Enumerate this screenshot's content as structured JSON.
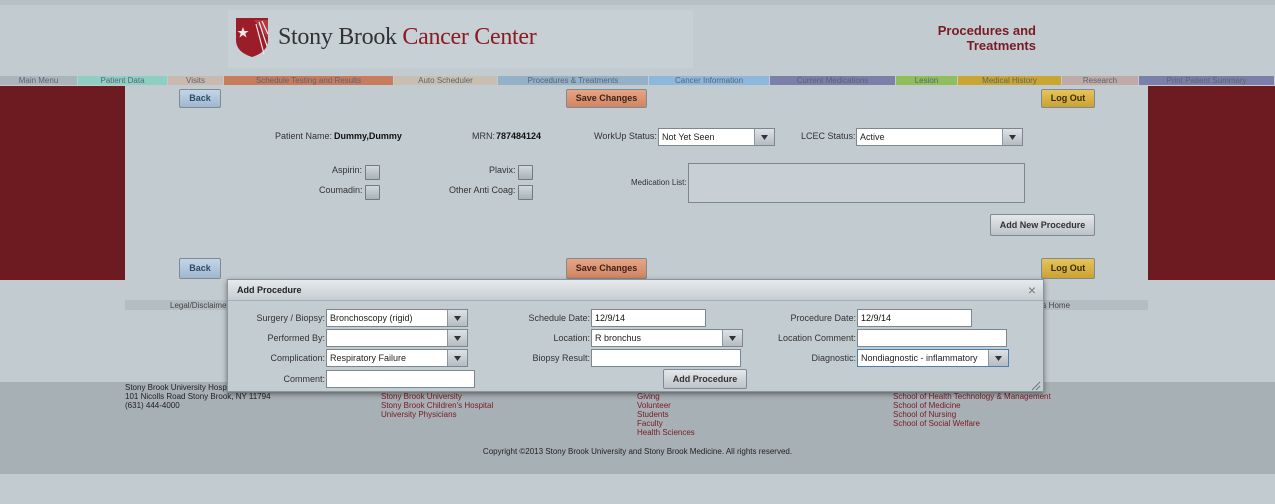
{
  "header": {
    "logo_brand_prefix": "Stony Brook",
    "logo_brand_suffix": "Cancer Center",
    "page_title": "Procedures and Treatments"
  },
  "nav": {
    "tabs": [
      {
        "label": "Main Menu",
        "color": "#a9b4bb"
      },
      {
        "label": "Patient Data",
        "color": "#8fcfc3"
      },
      {
        "label": "Visits",
        "color": "#c9b9ae"
      },
      {
        "label": "Schedule Testing and Results",
        "color": "#c97c5d"
      },
      {
        "label": "Auto Scheduler",
        "color": "#c8bfb0"
      },
      {
        "label": "Procedures & Treatments",
        "color": "#93b2c9"
      },
      {
        "label": "Cancer Information",
        "color": "#8db7dc"
      },
      {
        "label": "Current Medications",
        "color": "#7a80aa"
      },
      {
        "label": "Lesion",
        "color": "#8fbe5a"
      },
      {
        "label": "Medical History",
        "color": "#c9a631"
      },
      {
        "label": "Research",
        "color": "#c0aaa7"
      },
      {
        "label": "Print Patient Summary",
        "color": "#7a80aa"
      }
    ]
  },
  "toolbar": {
    "back_label": "Back",
    "save_label": "Save Changes",
    "logout_label": "Log Out"
  },
  "patient": {
    "name_label": "Patient Name:",
    "name_value": "Dummy,Dummy",
    "mrn_label": "MRN:",
    "mrn_value": "787484124",
    "workup_label": "WorkUp Status:",
    "workup_value": "Not Yet Seen",
    "lcec_label": "LCEC Status:",
    "lcec_value": "Active"
  },
  "medications": {
    "aspirin_label": "Aspirin:",
    "coumadin_label": "Coumadin:",
    "plavix_label": "Plavix:",
    "other_label": "Other Anti Coag:",
    "list_label": "Medication List:"
  },
  "add_new_procedure_label": "Add New Procedure",
  "legal": {
    "left_text": "Legal/Disclaime",
    "right_text": "ns Home"
  },
  "footer": {
    "col1": [
      "Stony Brook University Hosp",
      "101 Nicolls Road Stony Brook, NY 11794",
      "(631) 444-4000"
    ],
    "col2": [
      "Stony Brook University",
      "Stony Brook Children's Hospital",
      "University Physicians"
    ],
    "col3": [
      "Giving",
      "Volunteer",
      "Students",
      "Faculty",
      "Health Sciences"
    ],
    "col4": [
      "School of Health Technology & Management",
      "School of Medicine",
      "School of Nursing",
      "School of Social Welfare"
    ],
    "copyright": "Copyright ©2013 Stony Brook University and Stony Brook Medicine. All rights reserved."
  },
  "dialog": {
    "title": "Add Procedure",
    "close_symbol": "×",
    "surgery_label": "Surgery / Biopsy:",
    "surgery_value": "Bronchoscopy (rigid)",
    "performed_label": "Performed By:",
    "performed_value": "",
    "complication_label": "Complication:",
    "complication_value": "Respiratory Failure",
    "comment_label": "Comment:",
    "comment_value": "",
    "schedule_label": "Schedule Date:",
    "schedule_value": "12/9/14",
    "location_label": "Location:",
    "location_value": "R bronchus",
    "biopsy_label": "Biopsy Result:",
    "biopsy_value": "",
    "procedure_date_label": "Procedure Date:",
    "procedure_date_value": "12/9/14",
    "location_comment_label": "Location Comment:",
    "location_comment_value": "",
    "diagnostic_label": "Diagnostic:",
    "diagnostic_value": "Nondiagnostic - inflammatory",
    "add_button_label": "Add Procedure"
  }
}
